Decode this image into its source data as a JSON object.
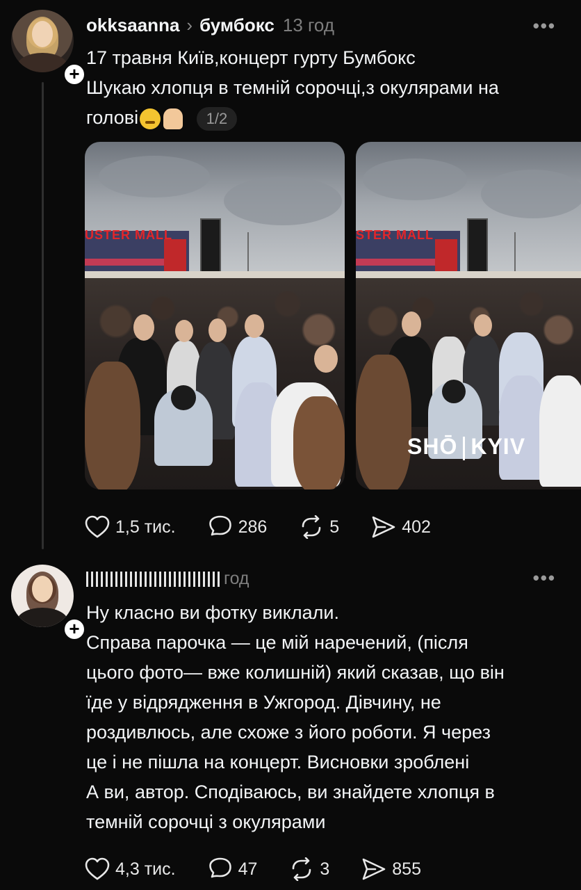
{
  "post1": {
    "username": "okksaanna",
    "chevron": "›",
    "community": "бумбокс",
    "timestamp": "13 год",
    "more": "•••",
    "text_line1": "17 травня Київ,концерт гурту Бумбокс",
    "text_line2": "Шукаю хлопця в темній сорочці,з окулярами на",
    "text_line3": "голові",
    "emoji_icons": [
      "drooling-face-emoji",
      "pray-emoji"
    ],
    "image_counter": "1/2",
    "photo1": {
      "mall_sign": "USTER MALL"
    },
    "photo2": {
      "mall_sign": "STER MALL",
      "watermark_left": "SHŌ",
      "watermark_right": "KYIV"
    },
    "likes": "1,5 тис.",
    "comments": "286",
    "reposts": "5",
    "shares": "402"
  },
  "post2": {
    "timestamp": "год",
    "more": "•••",
    "lines": [
      "Ну класно ви фотку виклали.",
      "Справа парочка — це мій наречений, (після",
      "цього фото— вже колишній) який сказав, що він",
      "їде у відрядження в Ужгород. Дівчину, не",
      "роздивлюсь, але схоже з його роботи. Я через",
      "це і не пішла на концерт. Висновки зроблені",
      "А ви, автор. Сподіваюсь, ви знайдете хлопця в",
      "темній сорочці з окулярами"
    ],
    "likes": "4,3 тис.",
    "comments": "47",
    "reposts": "3",
    "shares": "855"
  },
  "colors": {
    "background": "#0a0a0a",
    "text": "#f3f5f7",
    "muted": "#7e7e7e",
    "thread_line": "#2f2f2f"
  },
  "icons": [
    "more-icon",
    "follow-plus-icon",
    "heart-icon",
    "comment-icon",
    "repost-icon",
    "share-icon"
  ]
}
